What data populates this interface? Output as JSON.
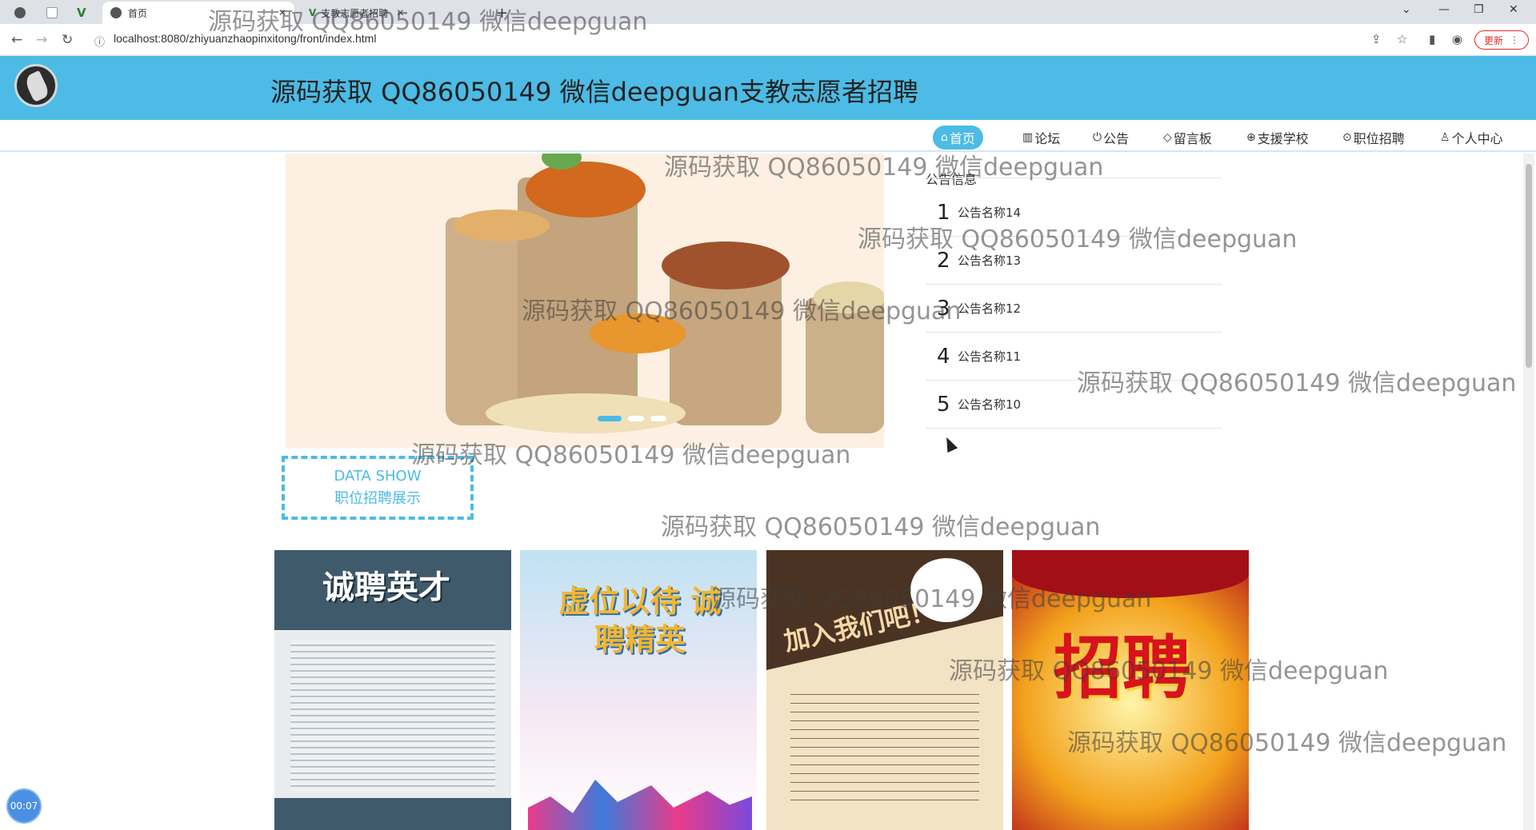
{
  "browser": {
    "tabs": [
      {
        "label": "首页",
        "active": true
      },
      {
        "label": "支教志愿者招聘",
        "active": false
      }
    ],
    "url": "localhost:8080/zhiyuanzhaopinxitong/front/index.html",
    "update_label": "更新"
  },
  "header": {
    "title": "源码获取 QQ86050149 微信deepguan支教志愿者招聘"
  },
  "nav": {
    "items": [
      {
        "icon": "⌂",
        "label": "首页",
        "active": true
      },
      {
        "icon": "▥",
        "label": "论坛"
      },
      {
        "icon": "⏻",
        "label": "公告"
      },
      {
        "icon": "◇",
        "label": "留言板"
      },
      {
        "icon": "⊕",
        "label": "支援学校"
      },
      {
        "icon": "⊙",
        "label": "职位招聘"
      },
      {
        "icon": "♙",
        "label": "个人中心"
      }
    ]
  },
  "notices": {
    "title": "公告信息",
    "items": [
      {
        "num": "1",
        "name": "公告名称14"
      },
      {
        "num": "2",
        "name": "公告名称13"
      },
      {
        "num": "3",
        "name": "公告名称12"
      },
      {
        "num": "4",
        "name": "公告名称11"
      },
      {
        "num": "5",
        "name": "公告名称10"
      }
    ]
  },
  "datashow": {
    "line1": "DATA SHOW",
    "line2": "职位招聘展示"
  },
  "cards": [
    {
      "title": "诚聘英才"
    },
    {
      "title": "虚位以待 诚聘精英"
    },
    {
      "title": "加入我们吧！"
    },
    {
      "title": "招聘"
    }
  ],
  "watermark": "源码获取 QQ86050149 微信deepguan",
  "timer": "00:07",
  "colors": {
    "accent": "#4cbbe6"
  }
}
